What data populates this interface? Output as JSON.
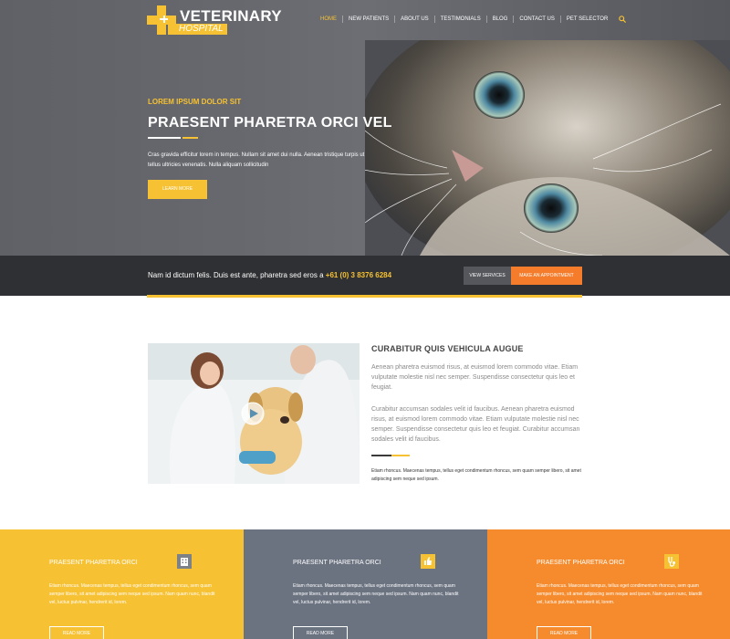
{
  "brand": {
    "name": "VETERINARY",
    "sub": "HOSPITAL",
    "accent": "#f6c132",
    "orange": "#f57c2b",
    "dark": "#2f3033"
  },
  "nav": {
    "items": [
      "HOME",
      "NEW PATIENTS",
      "ABOUT US",
      "TESTIMONIALS",
      "BLOG",
      "CONTACT US",
      "PET SELECTOR"
    ],
    "active_index": 0,
    "search_icon": "search-icon"
  },
  "hero": {
    "kicker": "LOREM IPSUM DOLOR SIT",
    "title": "PRAESENT PHARETRA ORCI VEL",
    "text": "Cras gravida efficitur lorem in tempus. Nullam sit amet dui nulla. Aenean tristique turpis ut tellus ultricies venenatis. Nulla aliquam sollicitudin",
    "button": "LEARN MORE"
  },
  "cta": {
    "text": "Nam id dictum felis. Duis est ante, pharetra sed eros a ",
    "phone": "+61 (0) 3 8376 6284",
    "view_services": "VIEW SERVICES",
    "appointment": "MAKE AN APPOINTMENT"
  },
  "about": {
    "title": "CURABITUR QUIS VEHICULA AUGUE",
    "p1": "Aenean pharetra euismod risus, at euismod lorem commodo vitae. Etiam vulputate molestie nisl nec semper. Suspendisse consectetur quis leo et feugiat.",
    "p2": "Curabitur accumsan sodales velit id faucibus. Aenean pharetra euismod risus, at euismod lorem commodo vitae. Etiam vulputate molestie nisl nec semper. Suspendisse consectetur quis leo et feugiat. Curabitur accumsan sodales velit id faucibus.",
    "small": "Etiam rhoncus. Maecenas tempus, tellus eget condimentum rhoncus, sem quam semper libero, sit amet adipiscing sem neque sed ipsum."
  },
  "features": [
    {
      "title": "PRAESENT PHARETRA ORCI",
      "icon": "building-icon",
      "text": "Etiam rhoncus. Maecenas tempus, tellus eget condimentum rhoncus, sem quam semper libero, sit amet adipiscing sem neque sed ipsum. Nam quam nunc, blandit vel, luctus pulvinar, hendrerit id, lorem.",
      "button": "READ MORE"
    },
    {
      "title": "PRAESENT PHARETRA ORCI",
      "icon": "thumbs-up-icon",
      "text": "Etiam rhoncus. Maecenas tempus, tellus eget condimentum rhoncus, sem quam semper libero, sit amet adipiscing sem neque sed ipsum. Nam quam nunc, blandit vel, luctus pulvinar, hendrerit id, lorem.",
      "button": "READ MORE"
    },
    {
      "title": "PRAESENT PHARETRA ORCI",
      "icon": "stethoscope-icon",
      "text": "Etiam rhoncus. Maecenas tempus, tellus eget condimentum rhoncus, sem quam semper libero, sit amet adipiscing sem neque sed ipsum. Nam quam nunc, blandit vel, luctus pulvinar, hendrerit id, lorem.",
      "button": "READ MORE"
    }
  ]
}
